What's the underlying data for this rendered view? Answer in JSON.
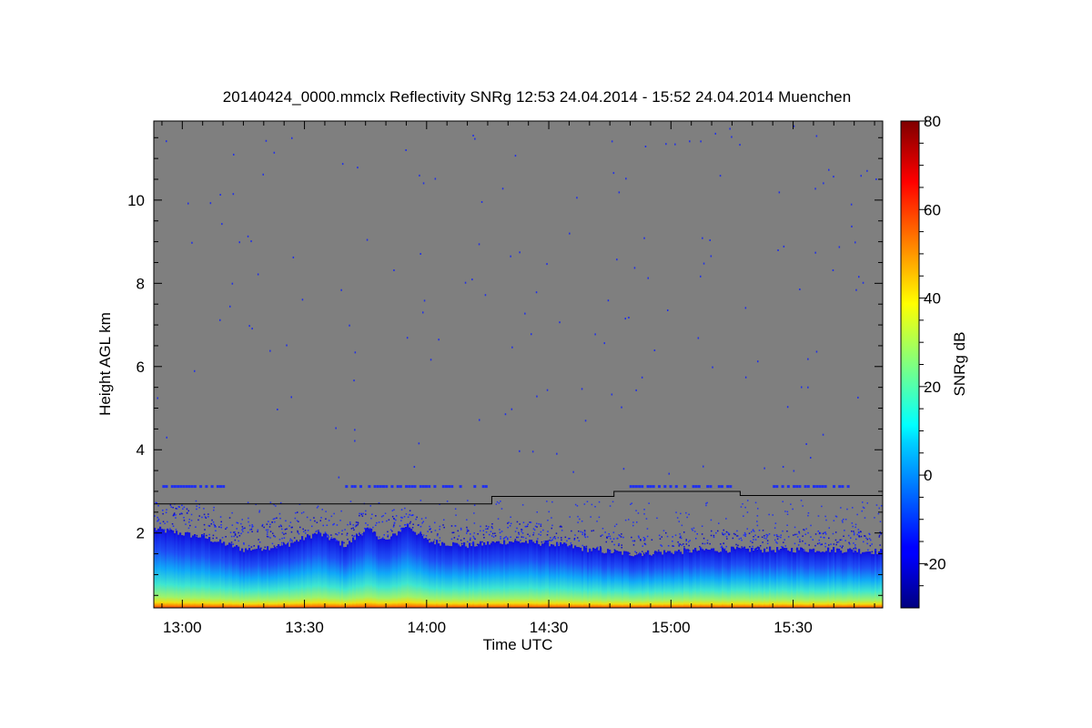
{
  "chart_data": {
    "type": "heatmap",
    "title": "20140424_0000.mmclx Reflectivity SNRg   12:53 24.04.2014 - 15:52 24.04.2014 Muenchen",
    "xlabel": "Time UTC",
    "ylabel": "Height AGL km",
    "x_range": [
      "12:53",
      "15:52"
    ],
    "x_ticks": [
      "13:00",
      "13:30",
      "14:00",
      "14:30",
      "15:00",
      "15:30"
    ],
    "ylim": [
      0.2,
      11.9
    ],
    "y_ticks": [
      2,
      4,
      6,
      8,
      10
    ],
    "background_color": "#7f7f7f",
    "colorbar": {
      "label": "SNRg dB",
      "range": [
        -30,
        80
      ],
      "ticks": [
        -20,
        0,
        20,
        40,
        60,
        80
      ],
      "colormap": "jet"
    },
    "signal_boundary_line": {
      "name": "",
      "color": "#000000",
      "points": [
        {
          "time": "12:53",
          "height_km": 2.7
        },
        {
          "time": "14:16",
          "height_km": 2.7
        },
        {
          "time": "14:16",
          "height_km": 2.88
        },
        {
          "time": "14:46",
          "height_km": 2.88
        },
        {
          "time": "14:46",
          "height_km": 3.0
        },
        {
          "time": "15:17",
          "height_km": 3.0
        },
        {
          "time": "15:17",
          "height_km": 2.9
        },
        {
          "time": "15:52",
          "height_km": 2.9
        }
      ]
    },
    "echo_top_km": [
      {
        "time": "12:53",
        "top": 2.1
      },
      {
        "time": "13:05",
        "top": 1.9
      },
      {
        "time": "13:15",
        "top": 1.6
      },
      {
        "time": "13:25",
        "top": 1.7
      },
      {
        "time": "13:33",
        "top": 2.0
      },
      {
        "time": "13:40",
        "top": 1.7
      },
      {
        "time": "13:45",
        "top": 2.1
      },
      {
        "time": "13:50",
        "top": 1.8
      },
      {
        "time": "13:55",
        "top": 2.2
      },
      {
        "time": "14:00",
        "top": 1.8
      },
      {
        "time": "14:10",
        "top": 1.7
      },
      {
        "time": "14:20",
        "top": 1.8
      },
      {
        "time": "14:30",
        "top": 1.75
      },
      {
        "time": "14:40",
        "top": 1.6
      },
      {
        "time": "14:50",
        "top": 1.5
      },
      {
        "time": "15:00",
        "top": 1.55
      },
      {
        "time": "15:10",
        "top": 1.6
      },
      {
        "time": "15:20",
        "top": 1.6
      },
      {
        "time": "15:30",
        "top": 1.6
      },
      {
        "time": "15:40",
        "top": 1.6
      },
      {
        "time": "15:52",
        "top": 1.55
      }
    ]
  }
}
